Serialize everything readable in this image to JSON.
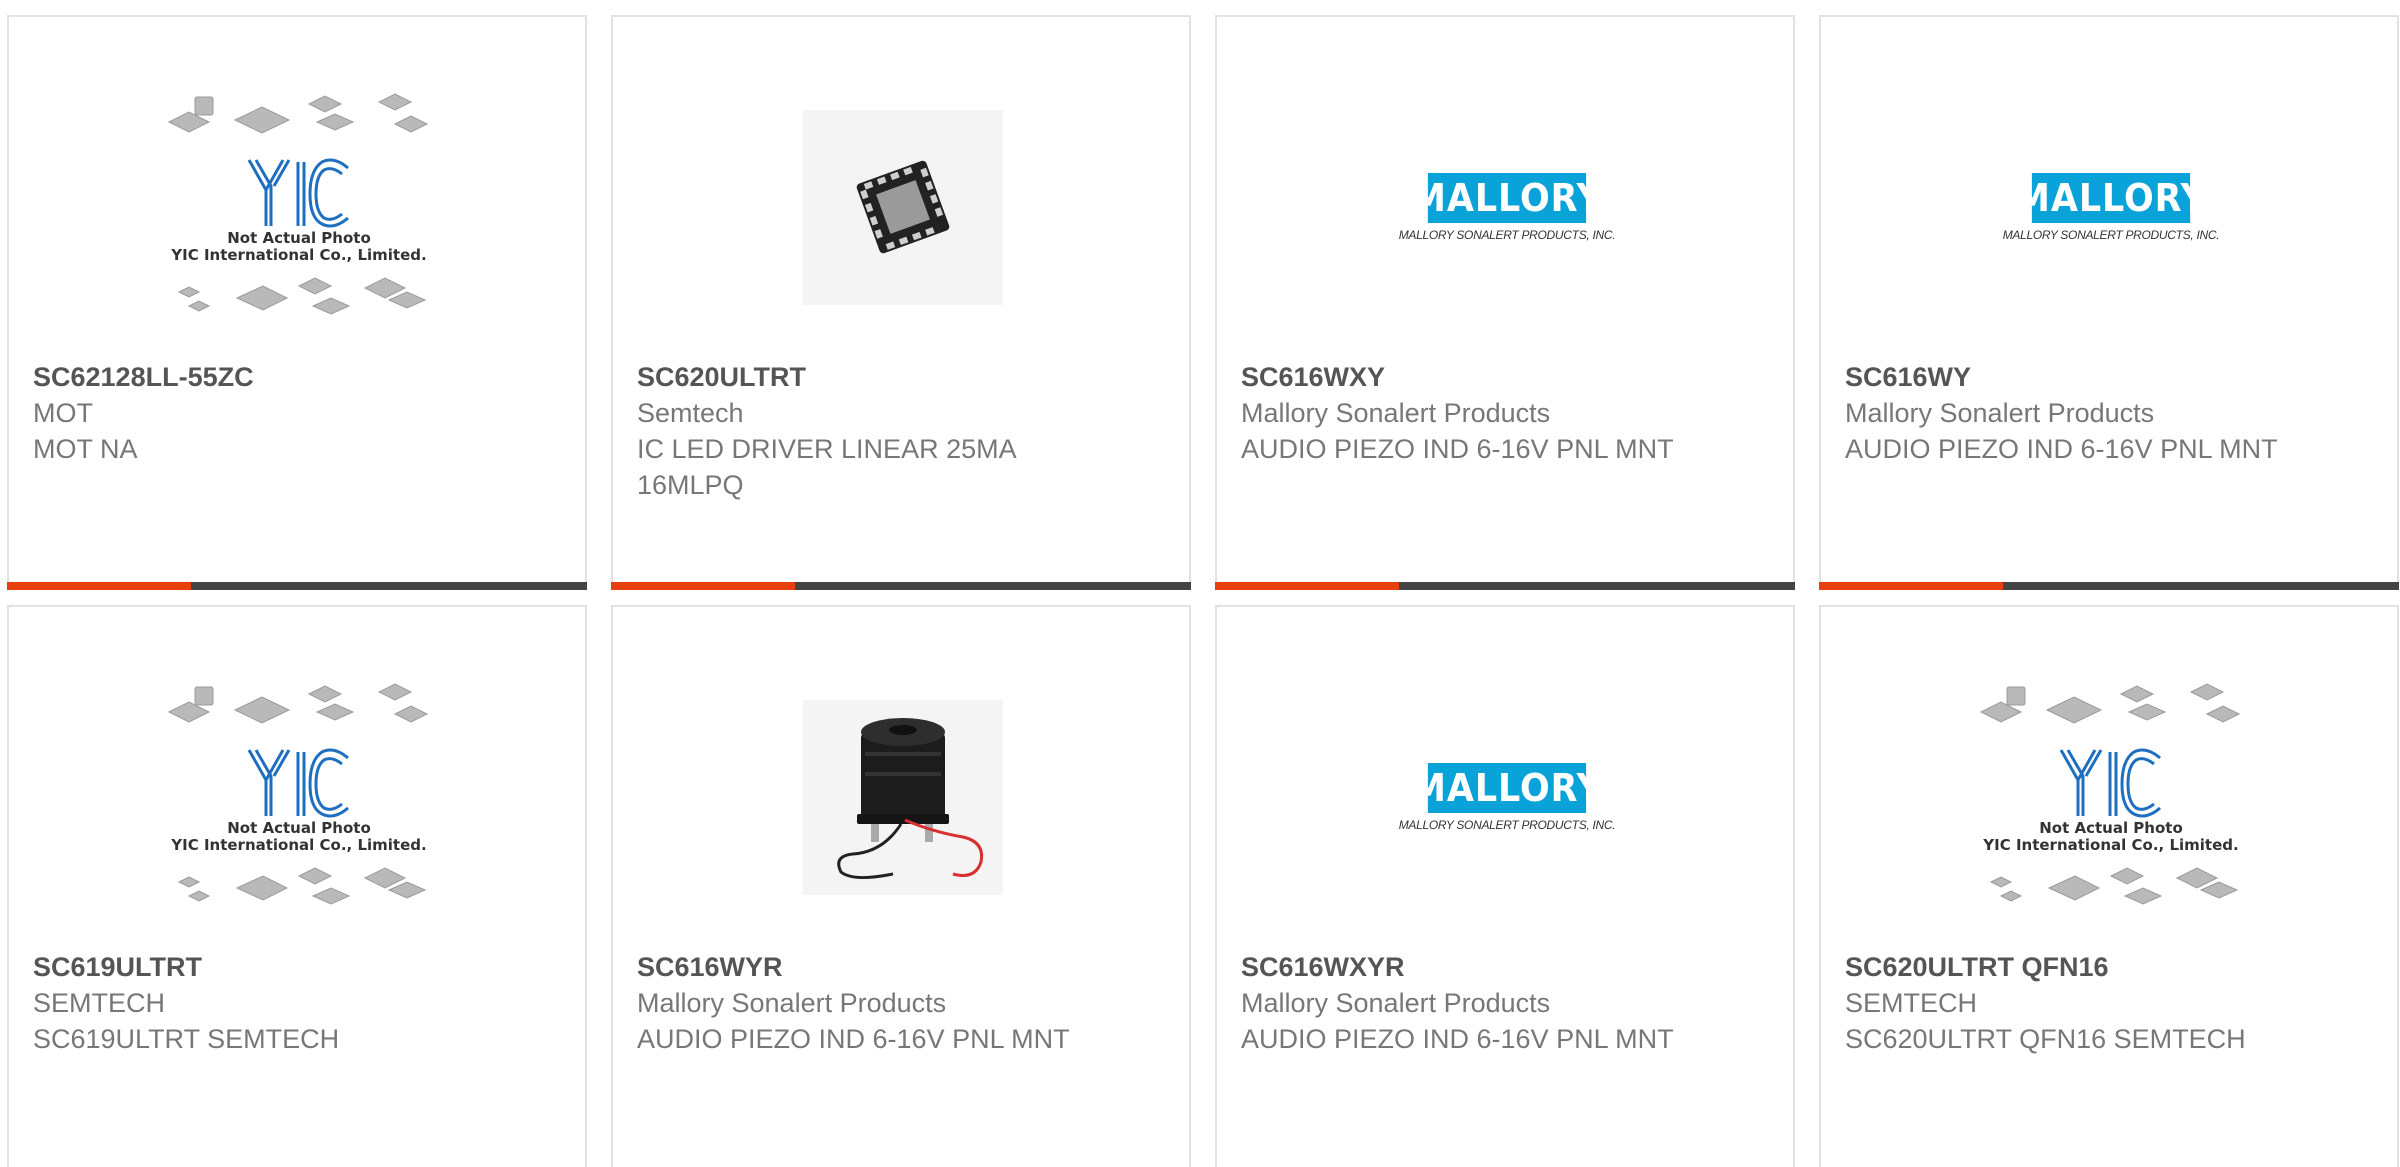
{
  "cards": [
    {
      "part_number": "SC62128LL-55ZC",
      "manufacturer": "MOT",
      "description": "MOT NA",
      "image_type": "yic-placeholder"
    },
    {
      "part_number": "SC620ULTRT",
      "manufacturer": "Semtech",
      "description": "IC LED DRIVER LINEAR 25MA 16MLPQ",
      "image_type": "qfn-chip-photo"
    },
    {
      "part_number": "SC616WXY",
      "manufacturer": "Mallory Sonalert Products",
      "description": "AUDIO PIEZO IND 6-16V PNL MNT",
      "image_type": "mallory-logo"
    },
    {
      "part_number": "SC616WY",
      "manufacturer": "Mallory Sonalert Products",
      "description": "AUDIO PIEZO IND 6-16V PNL MNT",
      "image_type": "mallory-logo"
    },
    {
      "part_number": "SC619ULTRT",
      "manufacturer": "SEMTECH",
      "description": "SC619ULTRT SEMTECH",
      "image_type": "yic-placeholder"
    },
    {
      "part_number": "SC616WYR",
      "manufacturer": "Mallory Sonalert Products",
      "description": "AUDIO PIEZO IND 6-16V PNL MNT",
      "image_type": "buzzer-photo"
    },
    {
      "part_number": "SC616WXYR",
      "manufacturer": "Mallory Sonalert Products",
      "description": "AUDIO PIEZO IND 6-16V PNL MNT",
      "image_type": "mallory-logo"
    },
    {
      "part_number": "SC620ULTRT QFN16",
      "manufacturer": "SEMTECH",
      "description": "SC620ULTRT QFN16 SEMTECH",
      "image_type": "yic-placeholder"
    }
  ],
  "placeholder": {
    "logo_text": "YIC",
    "line1": "Not Actual Photo",
    "line2": "YIC International Co., Limited."
  },
  "mallory": {
    "logo_text": "MALLORY",
    "sub_text": "MALLORY SONALERT PRODUCTS, INC."
  },
  "colors": {
    "accent": "#e8400c",
    "bar": "#444444",
    "yic_blue": "#1e6fc0",
    "mallory_blue": "#0aa3d9"
  }
}
